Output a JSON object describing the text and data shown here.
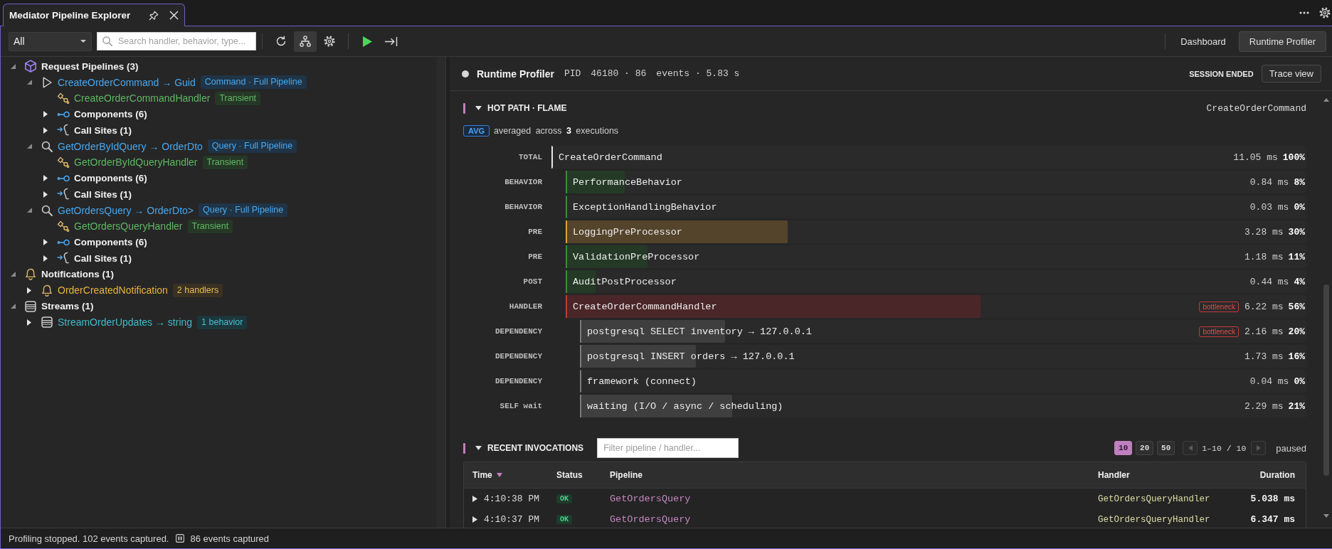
{
  "tab": {
    "title": "Mediator Pipeline Explorer",
    "selected": true
  },
  "toolbar": {
    "filter": {
      "value": "All"
    },
    "search": {
      "placeholder": "Search handler, behavior, type..."
    },
    "button_groups": [
      [
        {
          "kind": "refresh",
          "pressed": false
        },
        {
          "kind": "hierarchy",
          "pressed": true
        },
        {
          "kind": "settings",
          "pressed": false
        }
      ],
      [
        {
          "kind": "run",
          "pressed": false
        },
        {
          "kind": "step",
          "pressed": false
        }
      ]
    ],
    "views": [
      {
        "label": "Dashboard",
        "selected": false
      },
      {
        "label": "Runtime Profiler",
        "selected": true
      }
    ]
  },
  "tree": [
    {
      "kind": "pipelines",
      "label": "Request Pipelines (3)",
      "expanded": true,
      "children": [
        {
          "kind": "command",
          "label": "CreateOrderCommand → Guid",
          "badge": "Command · Full Pipeline",
          "expanded": true,
          "children": [
            {
              "kind": "handler",
              "label": "CreateOrderCommandHandler",
              "badge": "Transient"
            },
            {
              "kind": "components",
              "label": "Components (6)",
              "expanded": false
            },
            {
              "kind": "call_sites",
              "label": "Call Sites (1)",
              "expanded": false
            }
          ]
        },
        {
          "kind": "query",
          "label": "GetOrderByIdQuery → OrderDto",
          "badge": "Query · Full Pipeline",
          "expanded": true,
          "children": [
            {
              "kind": "handler",
              "label": "GetOrderByIdQueryHandler",
              "badge": "Transient"
            },
            {
              "kind": "components",
              "label": "Components (6)",
              "expanded": false
            },
            {
              "kind": "call_sites",
              "label": "Call Sites (1)",
              "expanded": false
            }
          ]
        },
        {
          "kind": "query",
          "label": "GetOrdersQuery → OrderDto>",
          "badge": "Query · Full Pipeline",
          "expanded": true,
          "children": [
            {
              "kind": "handler",
              "label": "GetOrdersQueryHandler",
              "badge": "Transient"
            },
            {
              "kind": "components",
              "label": "Components (6)",
              "expanded": false
            },
            {
              "kind": "call_sites",
              "label": "Call Sites (1)",
              "expanded": false
            }
          ]
        }
      ]
    },
    {
      "kind": "notifications",
      "label": "Notifications (1)",
      "expanded": true,
      "children": [
        {
          "kind": "notification",
          "label": "OrderCreatedNotification",
          "badge": "2 handlers",
          "expanded": false
        }
      ]
    },
    {
      "kind": "streams",
      "label": "Streams (1)",
      "expanded": true,
      "children": [
        {
          "kind": "stream",
          "label": "StreamOrderUpdates → string",
          "badge": "1 behavior",
          "expanded": false
        }
      ]
    }
  ],
  "profiler": {
    "title": "Runtime Profiler",
    "live": false,
    "meta": [
      "PID",
      "46180 · 86",
      "events · 5.83 s"
    ],
    "session": "SESSION ENDED",
    "action": "Trace view"
  },
  "hot_path": {
    "title": "HOT PATH · FLAME",
    "expanded": true,
    "target": "CreateOrderCommand",
    "badge": "AVG",
    "summary": "averaged across **3** executions",
    "flame": [
      {
        "kind": "total",
        "stage": "TOTAL",
        "name": "CreateOrderCommand",
        "time": "11.05 ms",
        "share": "100%",
        "children": [
          {
            "kind": "ok",
            "stage": "BEHAVIOR",
            "name": "PerformanceBehavior",
            "level": 0.08,
            "time": "0.84 ms",
            "share": "8%"
          },
          {
            "kind": "ok",
            "stage": "BEHAVIOR",
            "name": "ExceptionHandlingBehavior",
            "level": 0,
            "time": "0.03 ms",
            "share": "0%"
          },
          {
            "kind": "warn",
            "stage": "PRE",
            "name": "LoggingPreProcessor",
            "level": 0.3,
            "time": "3.28 ms",
            "share": "30%"
          },
          {
            "kind": "ok",
            "stage": "PRE",
            "name": "ValidationPreProcessor",
            "level": 0.11,
            "time": "1.18 ms",
            "share": "11%"
          },
          {
            "kind": "ok",
            "stage": "POST",
            "name": "AuditPostProcessor",
            "level": 0.04,
            "time": "0.44 ms",
            "share": "4%"
          },
          {
            "kind": "hot",
            "stage": "HANDLER",
            "name": "CreateOrderCommandHandler",
            "level": 0.56,
            "flag": "bottleneck",
            "time": "6.22 ms",
            "share": "56%",
            "children": [
              {
                "kind": "neutral",
                "stage": "DEPENDENCY",
                "name": "postgresql SELECT inventory → 127.0.0.1",
                "level": 0.2,
                "flag": "bottleneck",
                "time": "2.16 ms",
                "share": "20%"
              },
              {
                "kind": "neutral",
                "stage": "DEPENDENCY",
                "name": "postgresql INSERT orders → 127.0.0.1",
                "level": 0.16,
                "time": "1.73 ms",
                "share": "16%"
              },
              {
                "kind": "neutral",
                "stage": "DEPENDENCY",
                "name": "framework (connect)",
                "level": 0,
                "time": "0.04 ms",
                "share": "0%"
              },
              {
                "kind": "neutral",
                "stage": "SELF wait",
                "name": "waiting (I/O / async / scheduling)",
                "level": 0.21,
                "time": "2.29 ms",
                "share": "21%"
              }
            ]
          }
        ]
      }
    ]
  },
  "recent": {
    "title": "RECENT INVOCATIONS",
    "expanded": true,
    "filter": {
      "placeholder": "Filter pipeline / handler..."
    },
    "page_sizes": [
      {
        "label": "10",
        "selected": true
      },
      {
        "label": "20",
        "selected": false
      },
      {
        "label": "50",
        "selected": false
      }
    ],
    "previous": {
      "disabled": true
    },
    "range": "1–10 / 10",
    "next": {
      "disabled": true
    },
    "state": "paused",
    "columns": [
      {
        "label": "Time",
        "sorted": true
      },
      {
        "label": "Status",
        "sorted": false
      },
      {
        "label": "Pipeline",
        "sorted": false
      },
      {
        "label": "Handler",
        "sorted": false
      },
      {
        "label": "Duration",
        "sorted": false
      }
    ],
    "rows": [
      {
        "expanded": false,
        "time": "4:10:38 PM",
        "status": "OK",
        "pipeline": "GetOrdersQuery",
        "handler": "GetOrdersQueryHandler",
        "duration": "5.038 ms"
      },
      {
        "expanded": false,
        "time": "4:10:37 PM",
        "status": "OK",
        "pipeline": "GetOrdersQuery",
        "handler": "GetOrdersQueryHandler",
        "duration": "6.347 ms"
      }
    ]
  },
  "status_bar": {
    "message": "Profiling stopped. 102 events captured.",
    "paused": true,
    "count": "86 events captured"
  }
}
